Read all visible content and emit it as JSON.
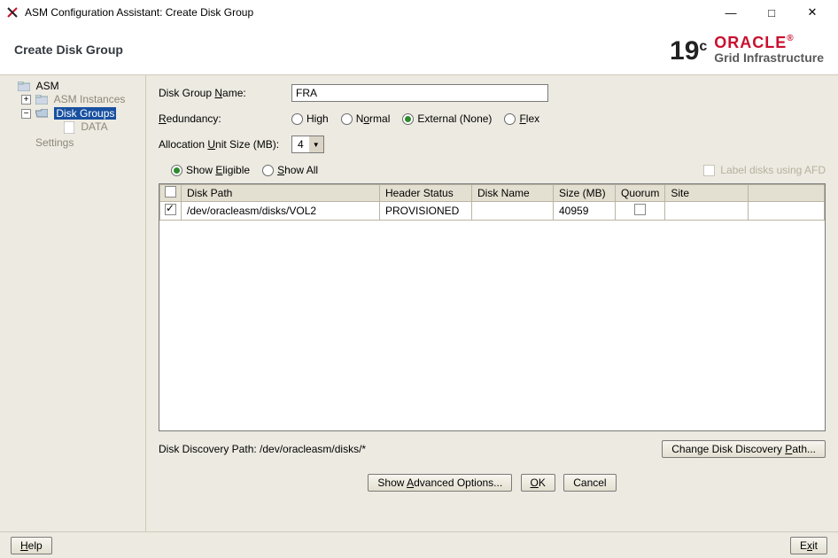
{
  "window": {
    "title": "ASM Configuration Assistant: Create Disk Group"
  },
  "header": {
    "title": "Create Disk Group",
    "brand_version": "19",
    "brand_version_sup": "c",
    "brand_name": "ORACLE",
    "brand_sub": "Grid Infrastructure"
  },
  "sidebar": {
    "root": "ASM",
    "instances": "ASM Instances",
    "disk_groups": "Disk Groups",
    "data": "DATA",
    "settings": "Settings"
  },
  "form": {
    "disk_group_name_label": "Disk Group Name:",
    "disk_group_name_value": "FRA",
    "redundancy_label": "Redundancy:",
    "redundancy": {
      "high": "High",
      "normal": "Normal",
      "external": "External (None)",
      "flex": "Flex",
      "selected": "external"
    },
    "aus_label": "Allocation Unit Size (MB):",
    "aus_value": "4",
    "filter": {
      "show_eligible": "Show Eligible",
      "show_all": "Show All",
      "selected": "eligible",
      "label_afd": "Label disks using AFD"
    }
  },
  "table": {
    "headers": {
      "path": "Disk Path",
      "header_status": "Header Status",
      "disk_name": "Disk Name",
      "size": "Size (MB)",
      "quorum": "Quorum",
      "site": "Site"
    },
    "rows": [
      {
        "checked": true,
        "path": "/dev/oracleasm/disks/VOL2",
        "header_status": "PROVISIONED",
        "disk_name": "",
        "size": "40959",
        "quorum": false,
        "site": ""
      }
    ]
  },
  "discovery": {
    "label": "Disk Discovery Path: ",
    "value": "/dev/oracleasm/disks/*",
    "change_btn": "Change Disk Discovery Path..."
  },
  "actions": {
    "advanced": "Show Advanced Options...",
    "ok": "OK",
    "cancel": "Cancel"
  },
  "footer": {
    "help": "Help",
    "exit": "Exit"
  }
}
